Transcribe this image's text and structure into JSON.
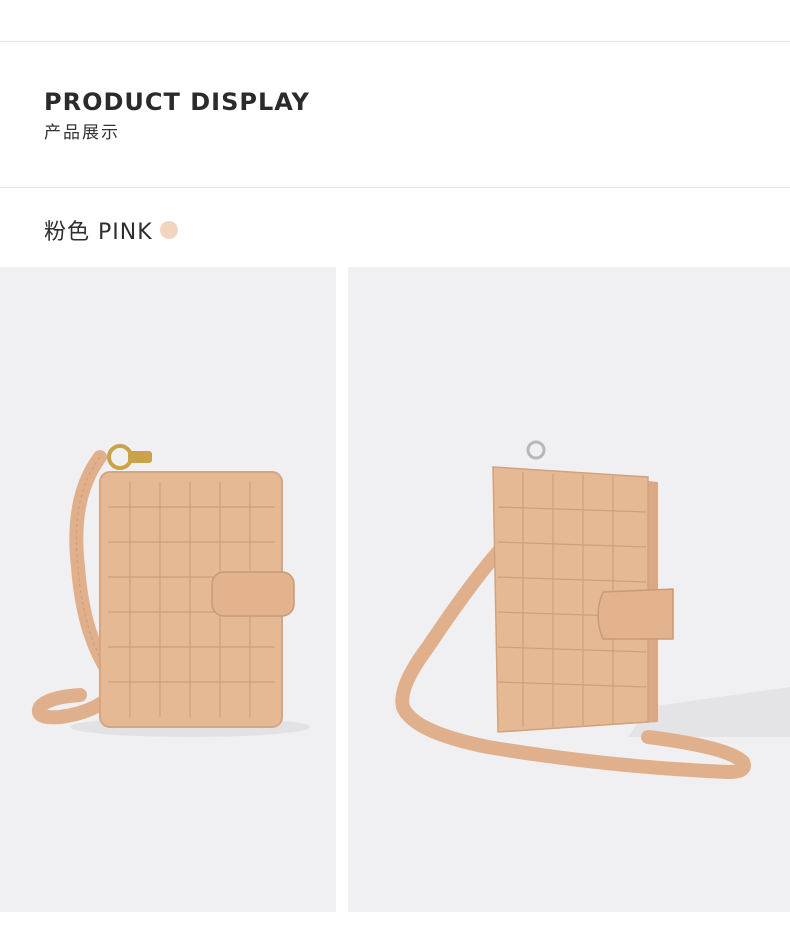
{
  "header": {
    "title_en": "PRODUCT DISPLAY",
    "title_cn": "产品展示"
  },
  "color_option": {
    "label": "粉色 PINK",
    "swatch_color": "#f2d5bf"
  },
  "colors": {
    "background": "#ffffff",
    "panel_bg": "#f0f0f2",
    "leather": "#e6b995",
    "leather_shadow": "#c99a76",
    "hardware": "#c9a24a"
  },
  "images": [
    {
      "icon": "wallet-front-photo"
    },
    {
      "icon": "wallet-angled-photo"
    }
  ]
}
